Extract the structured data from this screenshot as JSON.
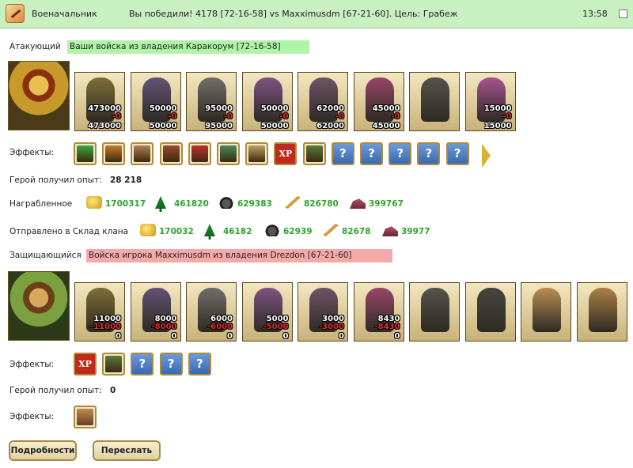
{
  "header": {
    "title": "Военачальник",
    "result": "Вы победили! 4178 [72-16-58] vs Maxximusdm [67-21-60]. Цель: Грабеж",
    "time": "13:58"
  },
  "attacker": {
    "label": "Атакующий",
    "owner": "Ваши войска из владения Каракорум [72-16-58]",
    "units": [
      {
        "n1": "473000",
        "loss": "-0",
        "n2": "473000",
        "color": "#6a5a20"
      },
      {
        "n1": "50000",
        "loss": "-0",
        "n2": "50000",
        "color": "#4a3a6a"
      },
      {
        "n1": "95000",
        "loss": "-0",
        "n2": "95000",
        "color": "#5a5a5a"
      },
      {
        "n1": "50000",
        "loss": "-0",
        "n2": "50000",
        "color": "#6a3a7a"
      },
      {
        "n1": "62000",
        "loss": "-0",
        "n2": "62000",
        "color": "#5a3a5a"
      },
      {
        "n1": "45000",
        "loss": "-0",
        "n2": "45000",
        "color": "#8a2a5a"
      },
      {
        "n1": "",
        "loss": "",
        "n2": "",
        "color": "#3a3a3a"
      },
      {
        "n1": "15000",
        "loss": "-0",
        "n2": "15000",
        "color": "#9a3a8a"
      }
    ],
    "effects_label": "Эффекты:",
    "effects": [
      "sword",
      "handshake",
      "hands",
      "fortress",
      "gift",
      "shield",
      "scroll",
      "XP",
      "battle-xp",
      "?",
      "?",
      "?",
      "?",
      "?"
    ],
    "exp_label": "Герой получил опыт:",
    "exp_value": "28 218",
    "loot_label": "Награбленное",
    "loot": [
      {
        "icon": "gold-icon",
        "value": "1700317"
      },
      {
        "icon": "wood-icon",
        "value": "461820"
      },
      {
        "icon": "stone-icon",
        "value": "629383"
      },
      {
        "icon": "grain-icon",
        "value": "826780"
      },
      {
        "icon": "iron-icon",
        "value": "399767"
      }
    ],
    "sent_label": "Отправлено в Склад клана",
    "sent": [
      {
        "icon": "gold-icon",
        "value": "170032"
      },
      {
        "icon": "wood-icon",
        "value": "46182"
      },
      {
        "icon": "stone-icon",
        "value": "62939"
      },
      {
        "icon": "grain-icon",
        "value": "82678"
      },
      {
        "icon": "iron-icon",
        "value": "39977"
      }
    ]
  },
  "defender": {
    "label": "Защищающийся",
    "owner": "Войска игрока Maxximusdm из владения Drezdon [67-21-60]",
    "units": [
      {
        "n1": "11000",
        "loss": "-11000",
        "n2": "0",
        "color": "#6a5a20"
      },
      {
        "n1": "8000",
        "loss": "-8000",
        "n2": "0",
        "color": "#4a3a6a"
      },
      {
        "n1": "6000",
        "loss": "-6000",
        "n2": "0",
        "color": "#5a5a5a"
      },
      {
        "n1": "5000",
        "loss": "-5000",
        "n2": "0",
        "color": "#6a3a7a"
      },
      {
        "n1": "3000",
        "loss": "-3000",
        "n2": "0",
        "color": "#5a3a5a"
      },
      {
        "n1": "8430",
        "loss": "-8430",
        "n2": "0",
        "color": "#8a2a5a"
      },
      {
        "n1": "",
        "loss": "",
        "n2": "",
        "color": "#3a3a3a"
      },
      {
        "n1": "",
        "loss": "",
        "n2": "",
        "color": "#2a2a2a"
      },
      {
        "n1": "",
        "loss": "",
        "n2": "",
        "color": "#b08040"
      },
      {
        "n1": "",
        "loss": "",
        "n2": "",
        "color": "#a07030"
      }
    ],
    "effects_label": "Эффекты:",
    "effects": [
      "XP",
      "battle-xp",
      "?",
      "?",
      "?"
    ],
    "exp_label": "Герой получил опыт:",
    "exp_value": "0",
    "effects2_label": "Эффекты:"
  },
  "buttons": {
    "details": "Подробности",
    "forward": "Переслать"
  },
  "colors": {
    "header_bg": "#c8f0c0",
    "attacker_box": "#aff5a8",
    "defender_box": "#f7a9a9",
    "resource_value": "#2da52d",
    "loss": "#e03030"
  }
}
